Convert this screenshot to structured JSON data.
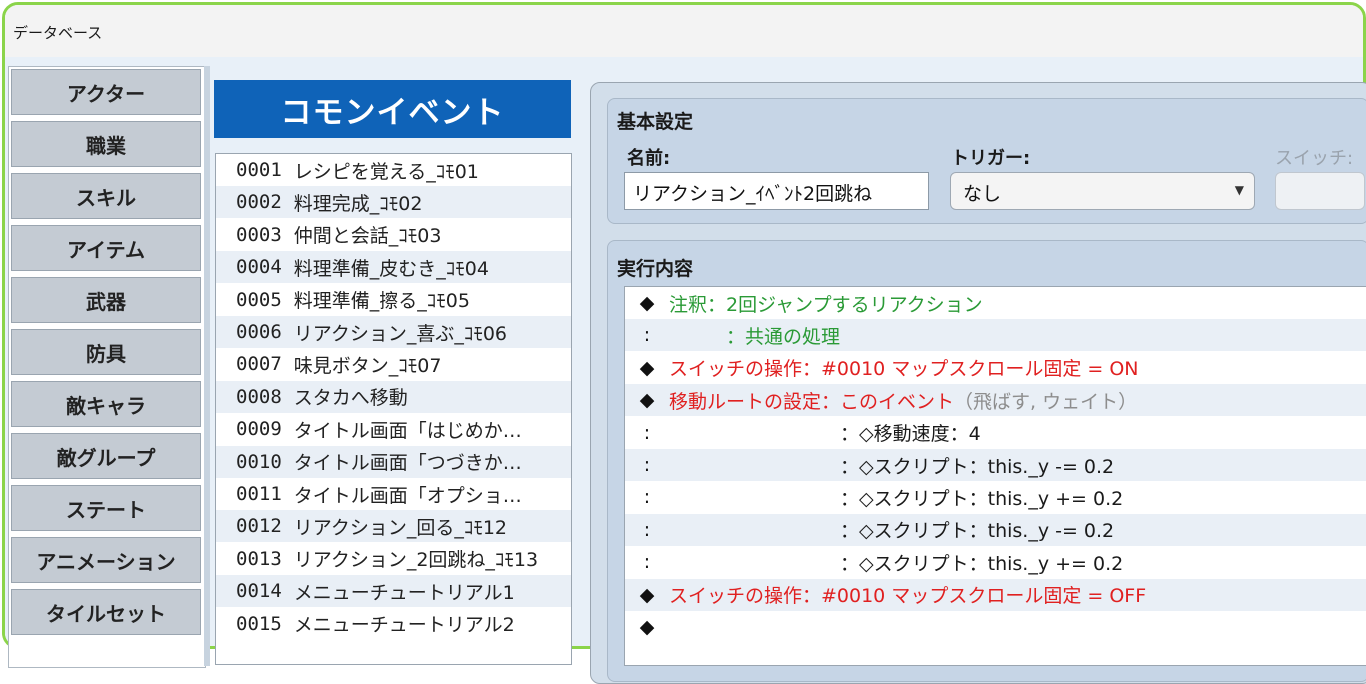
{
  "window": {
    "title": "データベース"
  },
  "categories": [
    "アクター",
    "職業",
    "スキル",
    "アイテム",
    "武器",
    "防具",
    "敵キャラ",
    "敵グループ",
    "ステート",
    "アニメーション",
    "タイルセット"
  ],
  "list": {
    "header": "コモンイベント",
    "items": [
      {
        "num": "0001",
        "name": "レシピを覚える_ｺﾓ01"
      },
      {
        "num": "0002",
        "name": "料理完成_ｺﾓ02"
      },
      {
        "num": "0003",
        "name": "仲間と会話_ｺﾓ03"
      },
      {
        "num": "0004",
        "name": "料理準備_皮むき_ｺﾓ04"
      },
      {
        "num": "0005",
        "name": "料理準備_擦る_ｺﾓ05"
      },
      {
        "num": "0006",
        "name": "リアクション_喜ぶ_ｺﾓ06"
      },
      {
        "num": "0007",
        "name": "味見ボタン_ｺﾓ07"
      },
      {
        "num": "0008",
        "name": "スタカへ移動"
      },
      {
        "num": "0009",
        "name": "タイトル画面「はじめか…"
      },
      {
        "num": "0010",
        "name": "タイトル画面「つづきか…"
      },
      {
        "num": "0011",
        "name": "タイトル画面「オプショ…"
      },
      {
        "num": "0012",
        "name": "リアクション_回る_ｺﾓ12"
      },
      {
        "num": "0013",
        "name": "リアクション_2回跳ね_ｺﾓ13"
      },
      {
        "num": "0014",
        "name": "メニューチュートリアル1"
      },
      {
        "num": "0015",
        "name": "メニューチュートリアル2"
      }
    ]
  },
  "basic": {
    "title": "基本設定",
    "name_label": "名前:",
    "name_value": "リアクション_ｲﾍﾞﾝﾄ2回跳ね",
    "trigger_label": "トリガー:",
    "trigger_value": "なし",
    "switch_label": "スイッチ:"
  },
  "exec": {
    "title": "実行内容",
    "commands": [
      {
        "lead": "◆",
        "text": "注釈：2回ジャンプするリアクション",
        "color": "#2a9a36"
      },
      {
        "lead": ":",
        "text": "　　　：共通の処理",
        "color": "#2a9a36"
      },
      {
        "lead": "◆",
        "text": "スイッチの操作：#0010 マップスクロール固定 = ON",
        "color": "#e02020"
      },
      {
        "lead": "◆",
        "text": "移動ルートの設定：このイベント",
        "suffix": "（飛ばす, ウェイト）",
        "color": "#e02020"
      },
      {
        "lead": ":",
        "text": "　　　　　　　　　：◇移動速度：4",
        "color": "#1a1a1a"
      },
      {
        "lead": ":",
        "text": "　　　　　　　　　：◇スクリプト：this._y -= 0.2",
        "color": "#1a1a1a"
      },
      {
        "lead": ":",
        "text": "　　　　　　　　　：◇スクリプト：this._y += 0.2",
        "color": "#1a1a1a"
      },
      {
        "lead": ":",
        "text": "　　　　　　　　　：◇スクリプト：this._y -= 0.2",
        "color": "#1a1a1a"
      },
      {
        "lead": ":",
        "text": "　　　　　　　　　：◇スクリプト：this._y += 0.2",
        "color": "#1a1a1a"
      },
      {
        "lead": "◆",
        "text": "スイッチの操作：#0010 マップスクロール固定 = OFF",
        "color": "#e02020"
      },
      {
        "lead": "◆",
        "text": "",
        "color": "#1a1a1a"
      }
    ]
  },
  "colors": {
    "header_blue": "#0f63b8",
    "frame_green": "#8bd44a"
  }
}
